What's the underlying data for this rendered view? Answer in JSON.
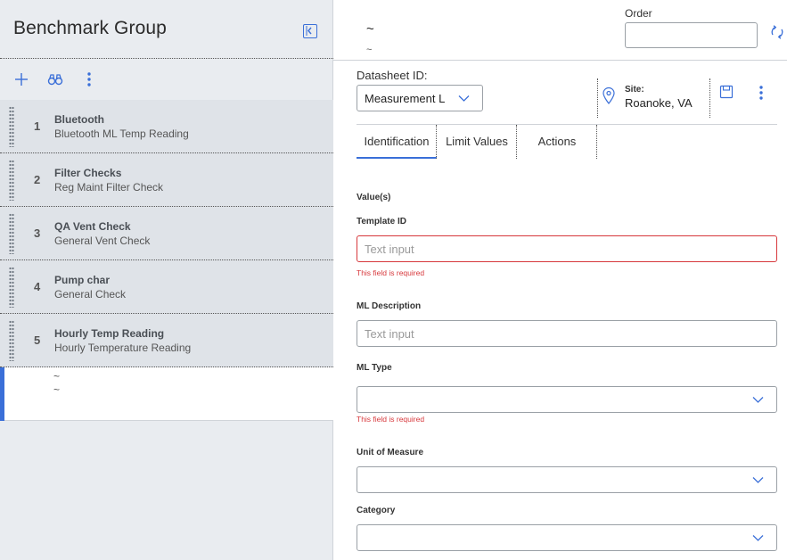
{
  "left_panel": {
    "title": "Benchmark Group",
    "items": [
      {
        "num": "1",
        "title": "Bluetooth",
        "subtitle": "Bluetooth ML Temp Reading"
      },
      {
        "num": "2",
        "title": "Filter Checks",
        "subtitle": "Reg Maint Filter Check"
      },
      {
        "num": "3",
        "title": "QA Vent Check",
        "subtitle": "General Vent Check"
      },
      {
        "num": "4",
        "title": "Pump char",
        "subtitle": "General Check"
      },
      {
        "num": "5",
        "title": "Hourly Temp Reading",
        "subtitle": "Hourly Temperature Reading"
      }
    ],
    "new_item": {
      "line1": "~",
      "line2": "~"
    }
  },
  "header": {
    "title": "~",
    "subtitle": "~",
    "order_label": "Order",
    "order_value": ""
  },
  "datasheet": {
    "label": "Datasheet ID:",
    "selected": "Measurement Lo",
    "site_label": "Site:",
    "site_value": "Roanoke, VA"
  },
  "tabs": [
    {
      "label": "Identification",
      "active": true
    },
    {
      "label": "Limit Values",
      "active": false
    },
    {
      "label": "Actions",
      "active": false
    }
  ],
  "form": {
    "section_label": "Value(s)",
    "template_id": {
      "label": "Template ID",
      "placeholder": "Text input",
      "error": "This field is required"
    },
    "ml_description": {
      "label": "ML Description",
      "placeholder": "Text input"
    },
    "ml_type": {
      "label": "ML Type",
      "error": "This field is required"
    },
    "unit_of_measure": {
      "label": "Unit of Measure"
    },
    "category": {
      "label": "Category"
    }
  },
  "colors": {
    "accent": "#3a6fd8",
    "error": "#d7383c",
    "left_bg": "#e9ecf0"
  }
}
